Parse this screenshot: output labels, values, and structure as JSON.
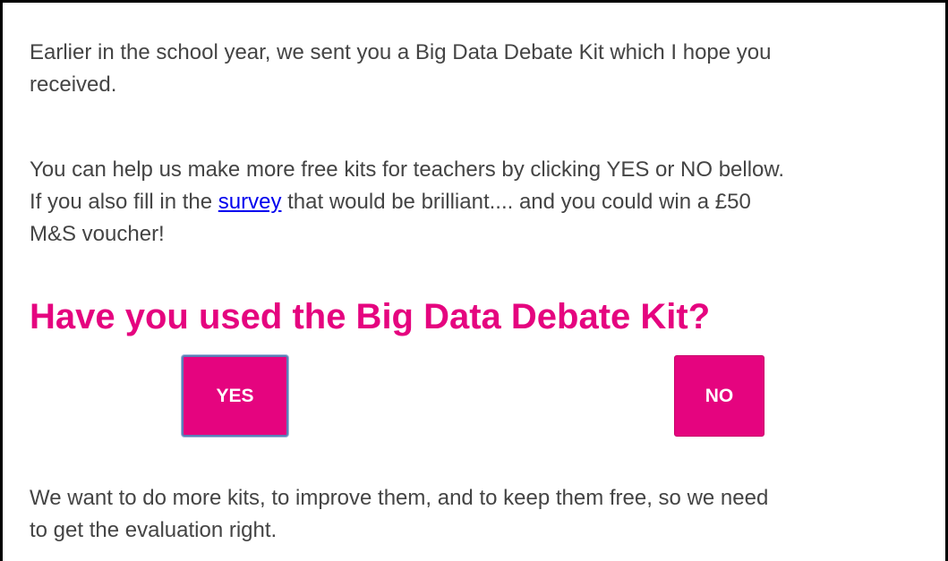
{
  "email": {
    "paragraph1": {
      "line1": "Earlier in the school year, we sent you a Big Data Debate Kit which I hope you",
      "line2": "received."
    },
    "paragraph2": {
      "line1": "You can help us make more free kits for teachers by clicking YES or NO bellow.",
      "line2_before_link": "If you also fill in the ",
      "link_text": "survey",
      "line2_after_link": " that would be brilliant.... and you could win a £50",
      "line3": "M&S voucher!"
    },
    "heading": "Have you used the Big Data Debate Kit?",
    "buttons": {
      "yes_label": "YES",
      "no_label": "NO"
    },
    "paragraph3": {
      "line1": "We want to do more kits, to improve them, and to keep them free, so we need",
      "line2": "to get the evaluation right."
    }
  },
  "colors": {
    "accent": "#e5047f",
    "body_text": "#444444",
    "link": "#0000ee",
    "frame_border": "#000000"
  }
}
